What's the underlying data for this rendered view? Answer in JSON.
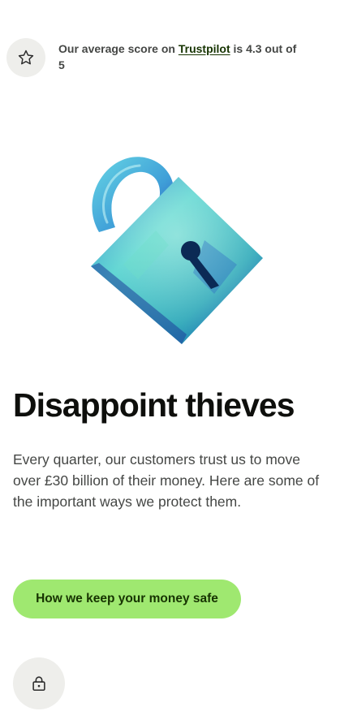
{
  "trust": {
    "icon": "star-icon",
    "prefix": "Our average score on ",
    "link": "Trustpilot",
    "suffix": " is 4.3 out of 5",
    "score": 4.3,
    "max": 5
  },
  "hero": {
    "icon": "padlock-illustration",
    "colors": [
      "#4ec9d8",
      "#2b63c6",
      "#0b2a55"
    ]
  },
  "headline": "Disappoint thieves",
  "body": "Every quarter, our customers trust us to move over £30 billion of their money. Here are some of the important ways we protect them.",
  "cta": {
    "label": "How we keep your money safe",
    "color": "#9fe870"
  },
  "footer_icon": "lock-icon"
}
